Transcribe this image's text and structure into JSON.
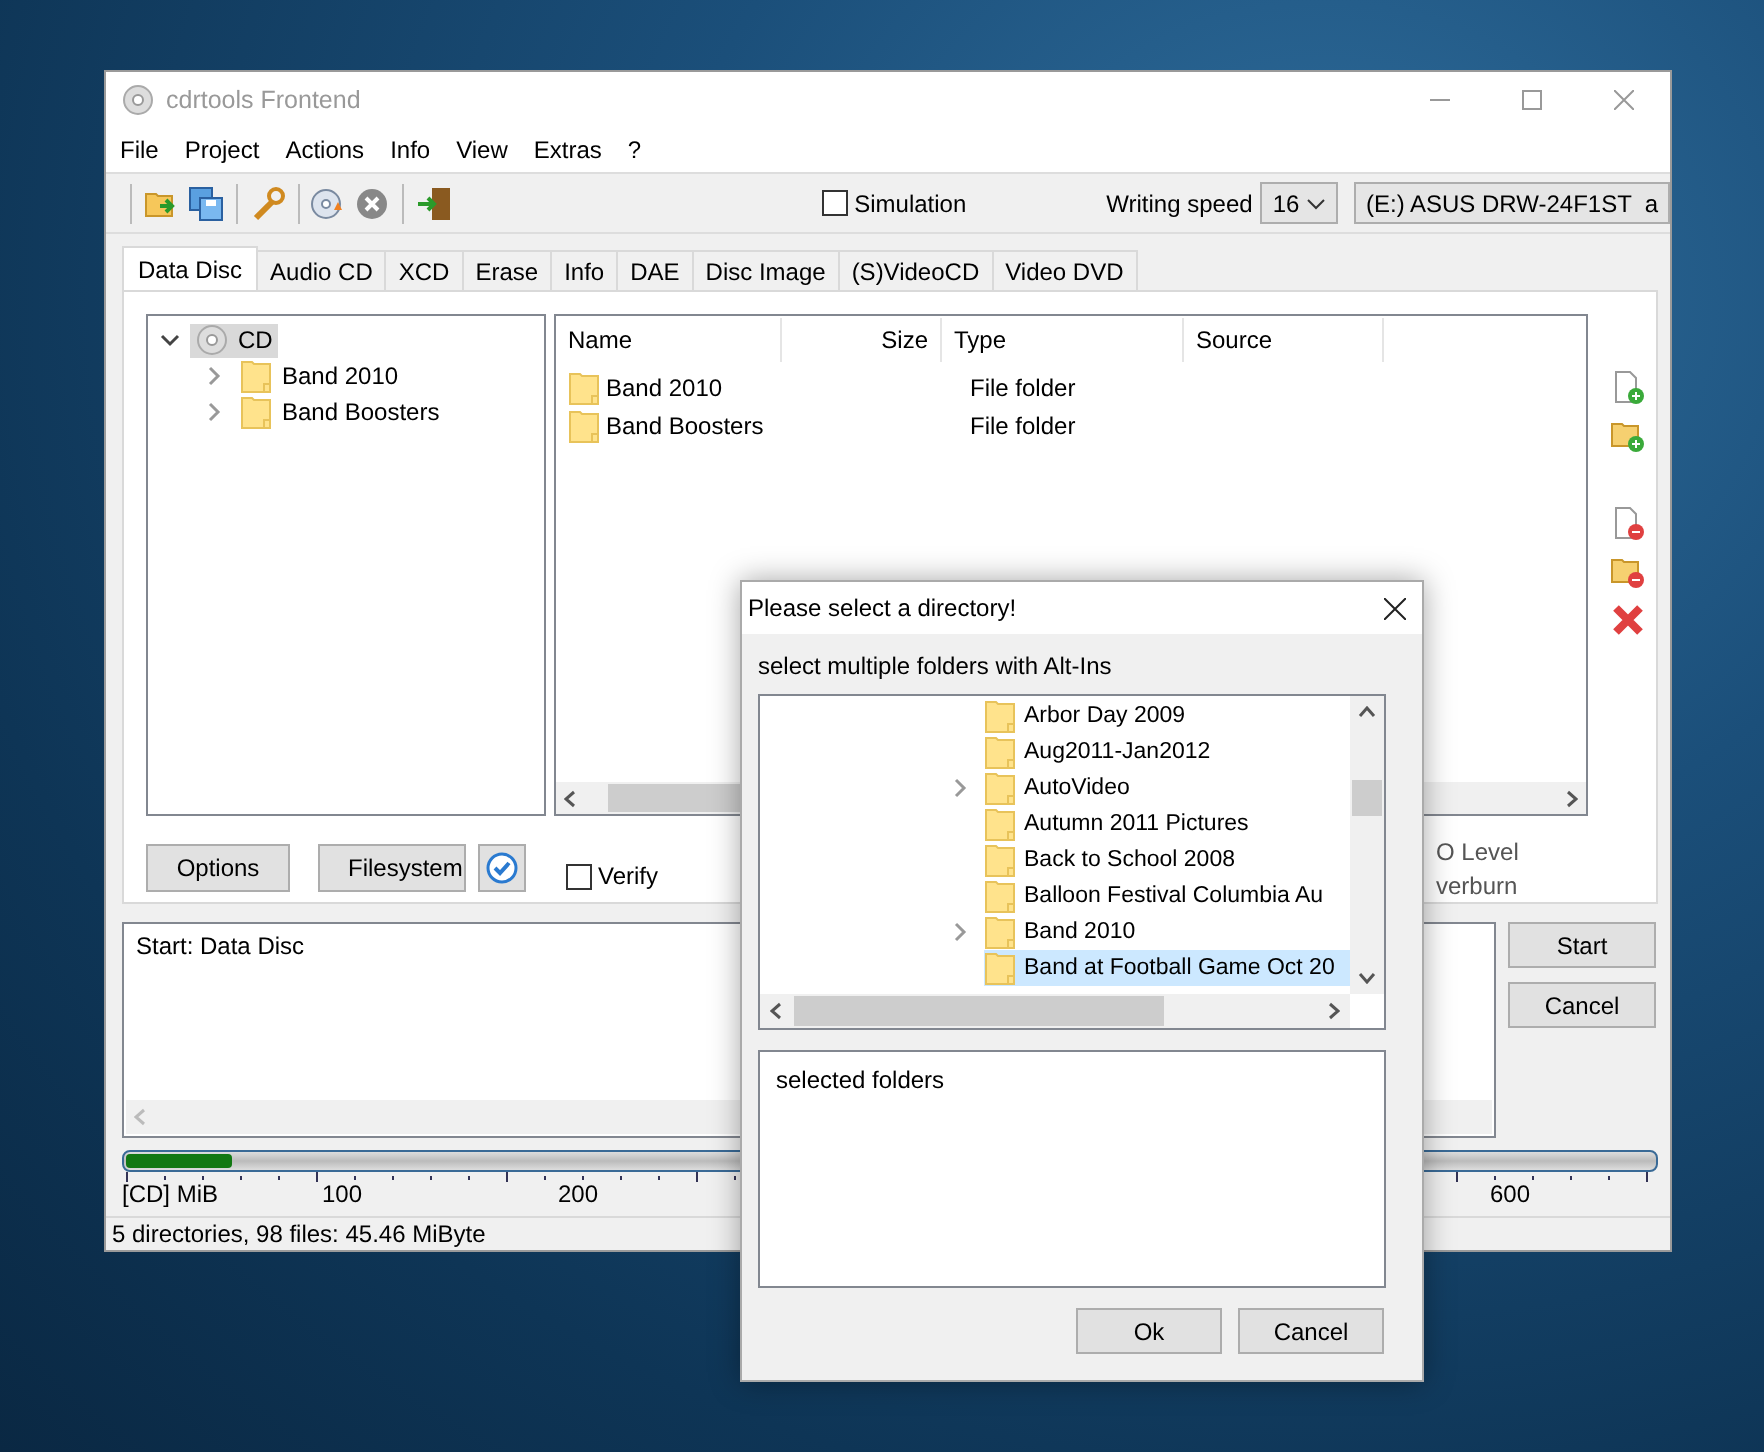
{
  "main_window": {
    "title": "cdrtools Frontend",
    "menu": [
      "File",
      "Project",
      "Actions",
      "Info",
      "View",
      "Extras",
      "?"
    ],
    "toolbar": {
      "simulation": {
        "label": "Simulation",
        "checked": false
      },
      "speed_label": "Writing speed",
      "speed": "16",
      "drive": "(E:) ASUS DRW-24F1ST  a"
    },
    "tabs": [
      {
        "label": "Data Disc",
        "selected": true
      },
      {
        "label": "Audio CD",
        "selected": false
      },
      {
        "label": "XCD",
        "selected": false
      },
      {
        "label": "Erase",
        "selected": false
      },
      {
        "label": "Info",
        "selected": false
      },
      {
        "label": "DAE",
        "selected": false
      },
      {
        "label": "Disc Image",
        "selected": false
      },
      {
        "label": "(S)VideoCD",
        "selected": false
      },
      {
        "label": "Video DVD",
        "selected": false
      }
    ],
    "tree": [
      {
        "label": "CD",
        "kind": "disc",
        "expanded": true,
        "selected": true,
        "children": [
          {
            "label": "Band 2010",
            "kind": "folder",
            "expanded": false,
            "selected": false
          },
          {
            "label": "Band Boosters",
            "kind": "folder",
            "expanded": false,
            "selected": false
          }
        ]
      }
    ],
    "file_list": {
      "columns": [
        "Name",
        "Size",
        "Type",
        "Source"
      ],
      "rows": [
        {
          "name": "Band 2010",
          "type": "File folder"
        },
        {
          "name": "Band Boosters",
          "type": "File folder"
        }
      ]
    },
    "panel_buttons": [
      "Options",
      "Filesystem"
    ],
    "verify": {
      "label": "Verify",
      "checked": false
    },
    "option_texts": [
      "O Level",
      "verburn"
    ],
    "log": [
      "Start: Data Disc"
    ],
    "actions": [
      "Start",
      "Cancel"
    ],
    "progress": {
      "level": 0.07
    },
    "scale_labels": [
      "[CD] MiB",
      "100",
      "200",
      "600"
    ],
    "status": "5 directories, 98 files: 45.46 MiByte"
  },
  "dialog": {
    "title": "Please select a directory!",
    "hint": "select multiple folders with Alt-Ins",
    "folders": [
      {
        "label": "Arbor Day 2009",
        "expandable": false,
        "selected": false
      },
      {
        "label": "Aug2011-Jan2012",
        "expandable": false,
        "selected": false
      },
      {
        "label": "AutoVideo",
        "expandable": true,
        "selected": false
      },
      {
        "label": "Autumn 2011 Pictures",
        "expandable": false,
        "selected": false
      },
      {
        "label": "Back to School 2008",
        "expandable": false,
        "selected": false
      },
      {
        "label": "Balloon Festival Columbia Au",
        "expandable": false,
        "selected": false
      },
      {
        "label": "Band 2010",
        "expandable": true,
        "selected": false
      },
      {
        "label": "Band at Football Game Oct 20",
        "expandable": false,
        "selected": true
      }
    ],
    "selected_label": "selected folders",
    "buttons": [
      "Ok",
      "Cancel"
    ]
  }
}
